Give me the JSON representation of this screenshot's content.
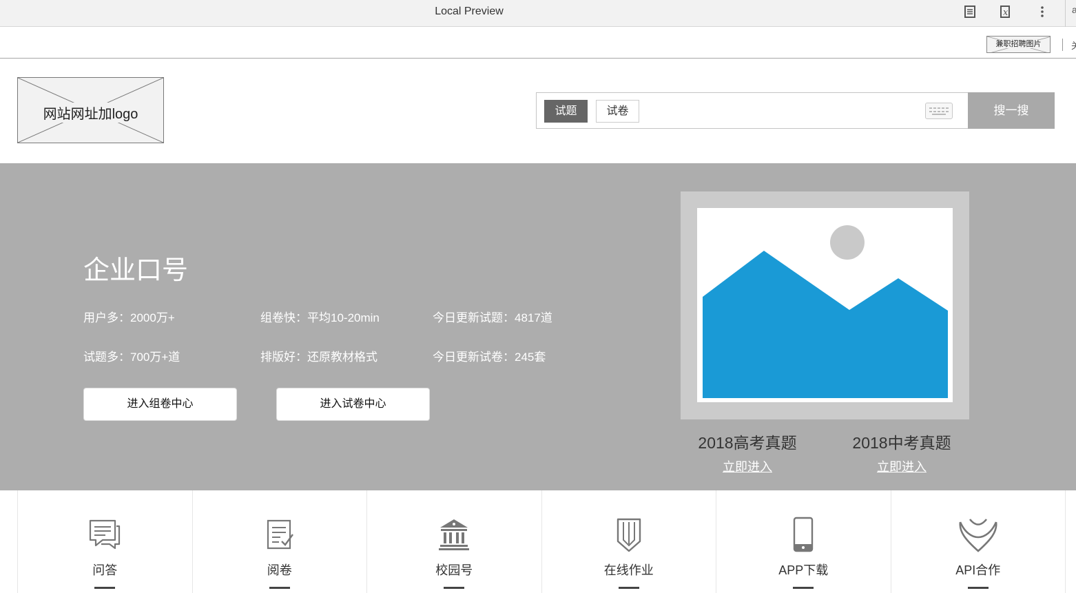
{
  "browser": {
    "title": "Local Preview",
    "icons": [
      "reader-icon",
      "script-icon",
      "more-vert-icon"
    ],
    "edge_char": "a"
  },
  "strip": {
    "recruit_label": "兼职招聘图片",
    "edge_char": "关"
  },
  "header": {
    "logo_text": "网站网址加logo",
    "search": {
      "tabs": [
        "试题",
        "试卷"
      ],
      "active_tab": "试题",
      "placeholder": "",
      "button_label": "搜一搜"
    }
  },
  "hero": {
    "slogan": "企业口号",
    "stats": [
      "用户多：2000万+",
      "组卷快：平均10-20min",
      "今日更新试题：4817道",
      "试题多：700万+道",
      "排版好：还原教材格式",
      "今日更新试卷：245套"
    ],
    "buttons": [
      "进入组卷中心",
      "进入试卷中心"
    ],
    "exams": [
      {
        "title": "2018高考真题",
        "link": "立即进入"
      },
      {
        "title": "2018中考真题",
        "link": "立即进入"
      }
    ],
    "colors": {
      "background": "#adadad",
      "image_blue": "#1a9ad6"
    }
  },
  "features": [
    {
      "label": "问答",
      "icon": "chat-icon"
    },
    {
      "label": "阅卷",
      "icon": "checklist-icon"
    },
    {
      "label": "校园号",
      "icon": "school-building-icon"
    },
    {
      "label": "在线作业",
      "icon": "pencil-icon"
    },
    {
      "label": "APP下载",
      "icon": "phone-icon"
    },
    {
      "label": "API合作",
      "icon": "ribbon-icon"
    }
  ]
}
